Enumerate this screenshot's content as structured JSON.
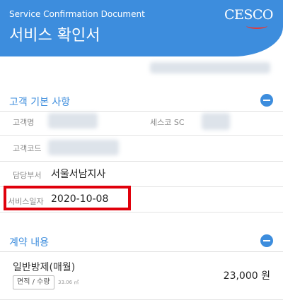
{
  "header": {
    "subtitle": "Service Confirmation Document",
    "title": "서비스 확인서",
    "logo": "CESCO"
  },
  "basic_section": {
    "title": "고객 기본 사항",
    "fields": {
      "customer_name_label": "고객명",
      "sesco_sc_label": "세스코 SC",
      "customer_code_label": "고객코드",
      "branch_label": "담당부서",
      "branch_value": "서울서남지사",
      "service_date_label": "서비스일자",
      "service_date_value": "2020-10-08"
    }
  },
  "contract_section": {
    "title": "계약 내용",
    "item_name": "일반방제(매월)",
    "chip_label": "면적 / 수량",
    "area_value": "33.06 ㎡",
    "price": "23,000 원"
  }
}
